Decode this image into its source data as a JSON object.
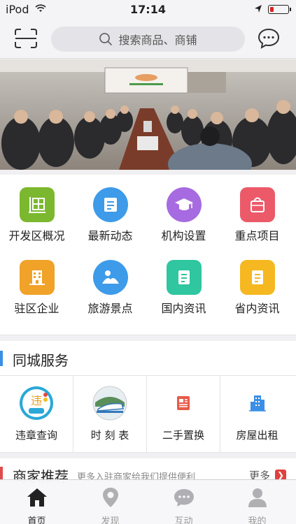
{
  "status_bar": {
    "carrier": "iPod",
    "time": "17:14"
  },
  "header": {
    "search_placeholder": "搜索商品、商铺"
  },
  "banner": {
    "icon": "conference-photo"
  },
  "grid": {
    "items": [
      {
        "label": "开发区概况",
        "color": "#7cb82f",
        "icon": "building-board-icon"
      },
      {
        "label": "最新动态",
        "color": "#3d9be9",
        "icon": "news-icon"
      },
      {
        "label": "机构设置",
        "color": "#a66be0",
        "icon": "mortarboard-icon"
      },
      {
        "label": "重点项目",
        "color": "#ec5a6a",
        "icon": "bag-icon"
      },
      {
        "label": "驻区企业",
        "color": "#f0a229",
        "icon": "office-building-icon"
      },
      {
        "label": "旅游景点",
        "color": "#3d9be9",
        "icon": "landscape-icon"
      },
      {
        "label": "国内资讯",
        "color": "#2fc6a0",
        "icon": "document-icon"
      },
      {
        "label": "省内资讯",
        "color": "#f5b820",
        "icon": "document-icon"
      }
    ]
  },
  "city_service": {
    "title": "同城服务",
    "items": [
      {
        "label": "违章查询",
        "icon": "traffic-violation-icon"
      },
      {
        "label": "时 刻 表",
        "icon": "train-icon"
      },
      {
        "label": "二手置换",
        "icon": "newspaper-icon"
      },
      {
        "label": "房屋出租",
        "icon": "apartment-icon"
      }
    ]
  },
  "merchants": {
    "title": "商家推荐",
    "subtitle": "更多入驻商家给我们提供便利",
    "more": "更多"
  },
  "tabbar": {
    "items": [
      {
        "label": "首页",
        "icon": "home-icon",
        "active": true
      },
      {
        "label": "发现",
        "icon": "location-pin-icon",
        "active": false
      },
      {
        "label": "互动",
        "icon": "chat-icon",
        "active": false
      },
      {
        "label": "我的",
        "icon": "person-icon",
        "active": false
      }
    ]
  },
  "colors": {
    "accent_blue": "#3b8fe6",
    "accent_red": "#e04b4b"
  }
}
